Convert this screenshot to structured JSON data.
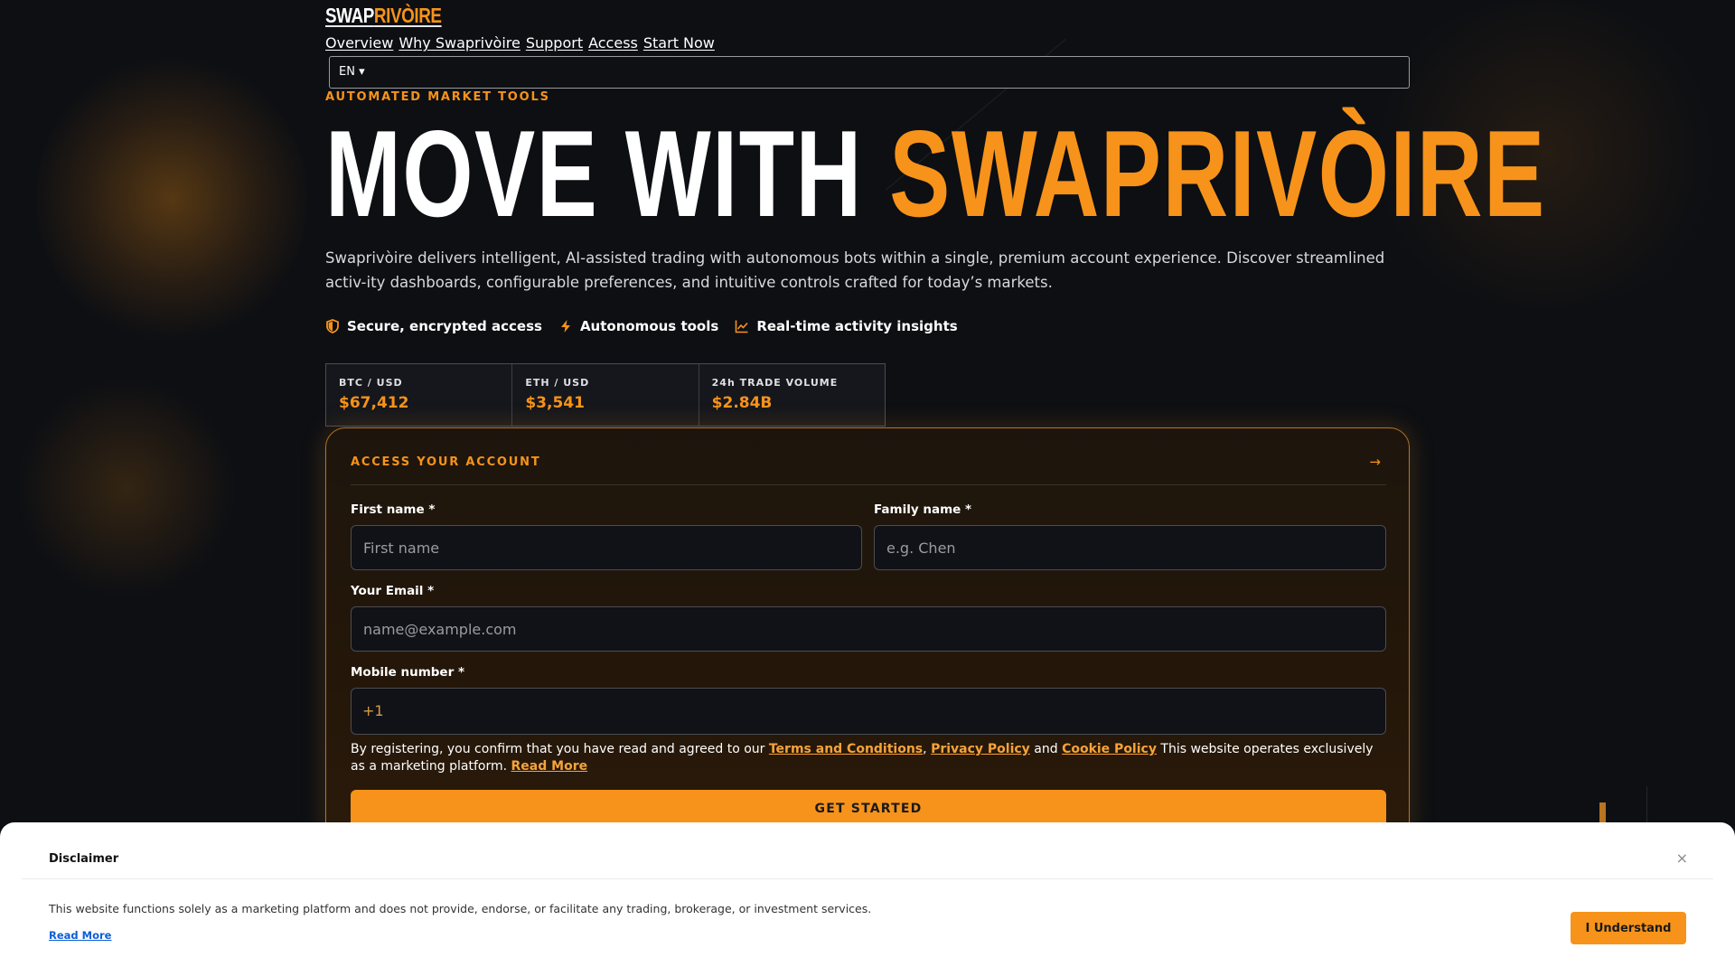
{
  "brand": {
    "part1": "SWAP",
    "part2": "RIVÒIRE"
  },
  "nav": [
    "Overview",
    "Why Swaprivòire",
    "Support",
    "Access",
    "Start Now"
  ],
  "language": "EN ▾",
  "eyebrow": "AUTOMATED MARKET TOOLS",
  "hero": {
    "line1": "MOVE WITH ",
    "line2": "SWAPRIVÒIRE"
  },
  "description": "Swaprivòire delivers intelligent, AI-assisted trading with autonomous bots within a single, premium account experience. Discover streamlined activ-ity dashboards, configurable preferences, and intuitive controls crafted for today’s markets.",
  "features": [
    {
      "icon": "shield-icon",
      "label": "Secure, encrypted access"
    },
    {
      "icon": "bolt-icon",
      "label": "Autonomous tools"
    },
    {
      "icon": "chart-line-icon",
      "label": "Real-time activity insights"
    }
  ],
  "ticker": [
    {
      "pair": "BTC / USD",
      "price": "$67,412"
    },
    {
      "pair": "ETH / USD",
      "price": "$3,541"
    },
    {
      "pair": "24h TRADE VOLUME",
      "price": "$2.84B"
    }
  ],
  "form": {
    "title": "ACCESS YOUR ACCOUNT",
    "first_name_label": "First name *",
    "first_name_placeholder": "First name",
    "family_name_label": "Family name *",
    "family_name_placeholder": "e.g. Chen",
    "email_label": "Your Email *",
    "email_placeholder": "name@example.com",
    "mobile_label": "Mobile number *",
    "mobile_prefix": "+1",
    "consent_prefix": "By registering, you confirm that you have read and agreed to our ",
    "terms_link": "Terms and Conditions",
    "comma": ", ",
    "privacy_link": "Privacy Policy",
    "and_text": " and ",
    "cookie_link": "Cookie Policy",
    "consent_suffix": " This website operates exclusively as a marketing platform. ",
    "read_more": "Read More",
    "submit_label": "GET STARTED"
  },
  "disclaimer": {
    "title": "Disclaimer",
    "close": "×",
    "text": "This website functions solely as a marketing platform and does not provide, endorse, or facilitate any trading, brokerage, or investment services.",
    "read_more": "Read More",
    "button": "I Understand"
  },
  "colors": {
    "accent": "#f7931a",
    "background": "#0d0f13",
    "card": "#241709"
  }
}
